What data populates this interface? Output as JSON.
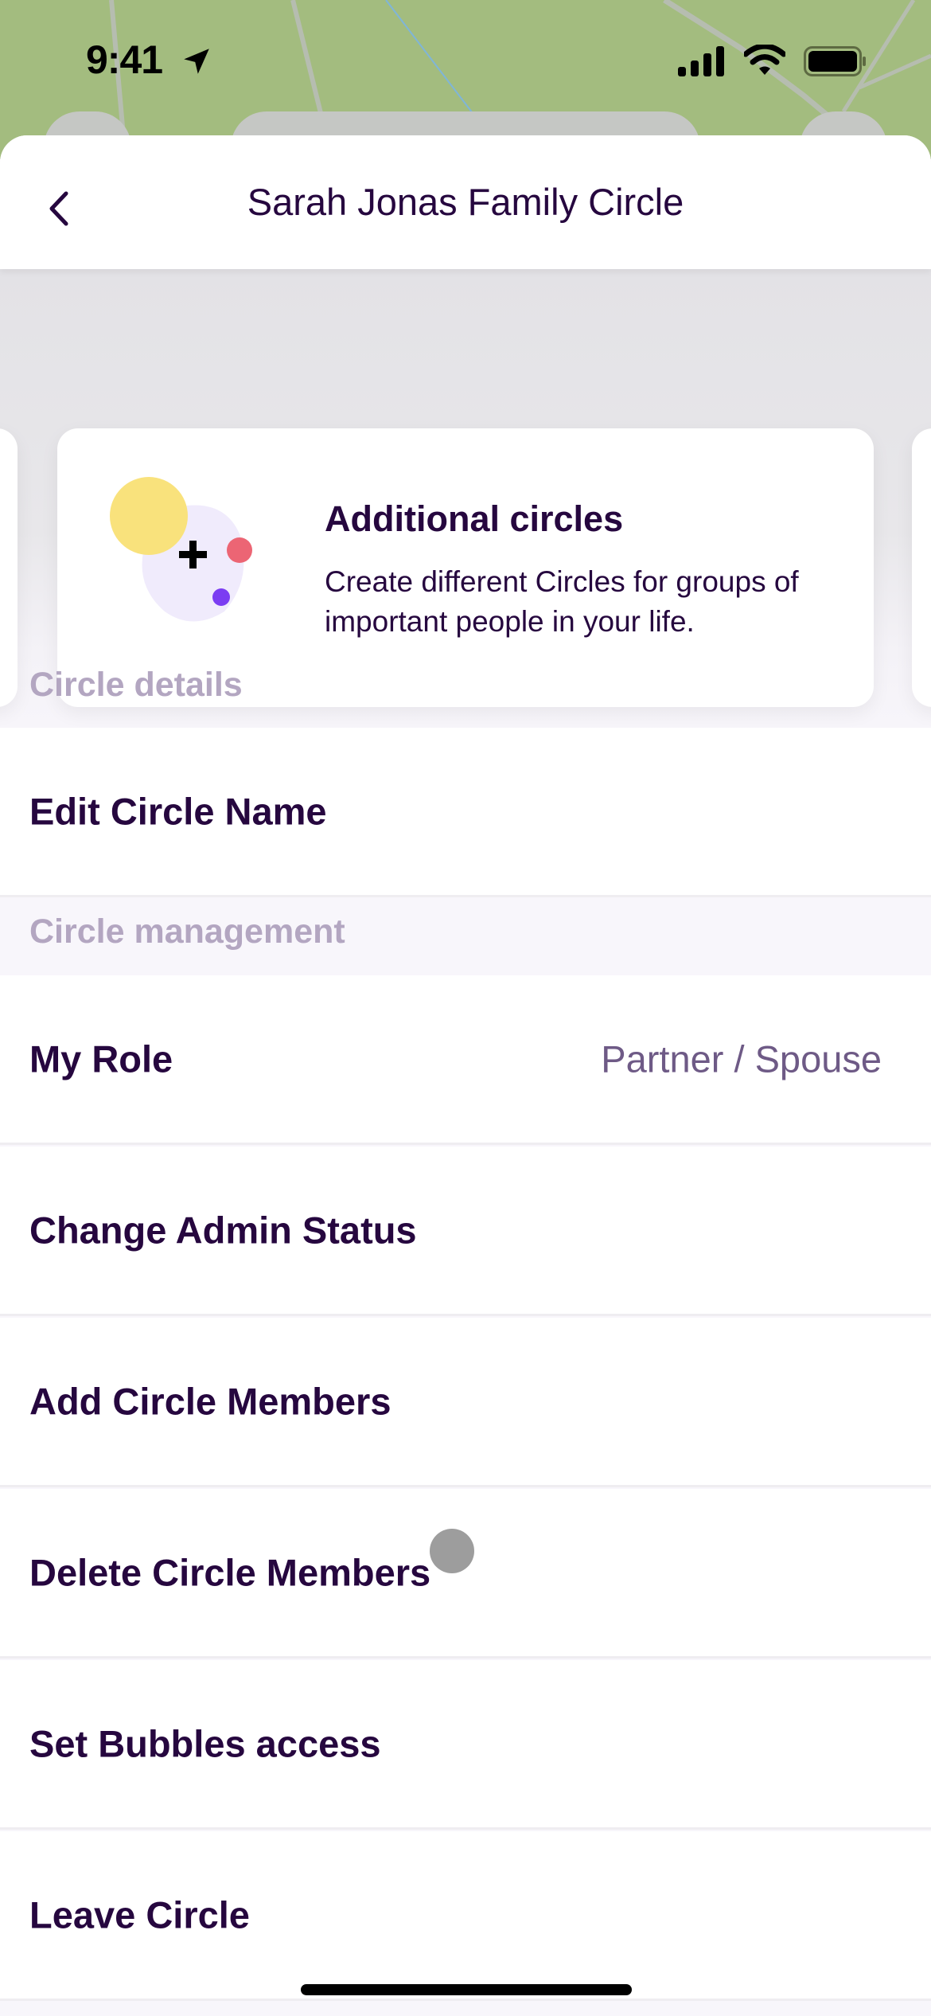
{
  "status_bar": {
    "time": "9:41",
    "icons": [
      "location-arrow-icon",
      "signal-icon",
      "wifi-icon",
      "battery-icon"
    ]
  },
  "header": {
    "title": "Sarah Jonas Family Circle",
    "back_icon": "chevron-left-icon"
  },
  "carousel": {
    "card": {
      "title": "Additional circles",
      "description": "Create different Circles for groups of important people in your life.",
      "illustration": "add-circles-illustration"
    },
    "page_count": 5,
    "active_page": 4
  },
  "sections": [
    {
      "label": "Circle details",
      "rows": [
        {
          "label": "Edit Circle Name"
        }
      ]
    },
    {
      "label": "Circle management",
      "rows": [
        {
          "label": "My Role",
          "value": "Partner / Spouse"
        },
        {
          "label": "Change Admin Status"
        },
        {
          "label": "Add Circle Members"
        },
        {
          "label": "Delete Circle Members"
        },
        {
          "label": "Set Bubbles access"
        },
        {
          "label": "Leave Circle"
        }
      ]
    }
  ],
  "colors": {
    "primary_text": "#26073f",
    "section_label": "#b3a6c1",
    "secondary_text": "#6e5a86",
    "accent": "#7b3df2",
    "illustration_yellow": "#f9e27c",
    "illustration_red": "#ec6574",
    "illustration_blob": "#f0ebfc"
  }
}
